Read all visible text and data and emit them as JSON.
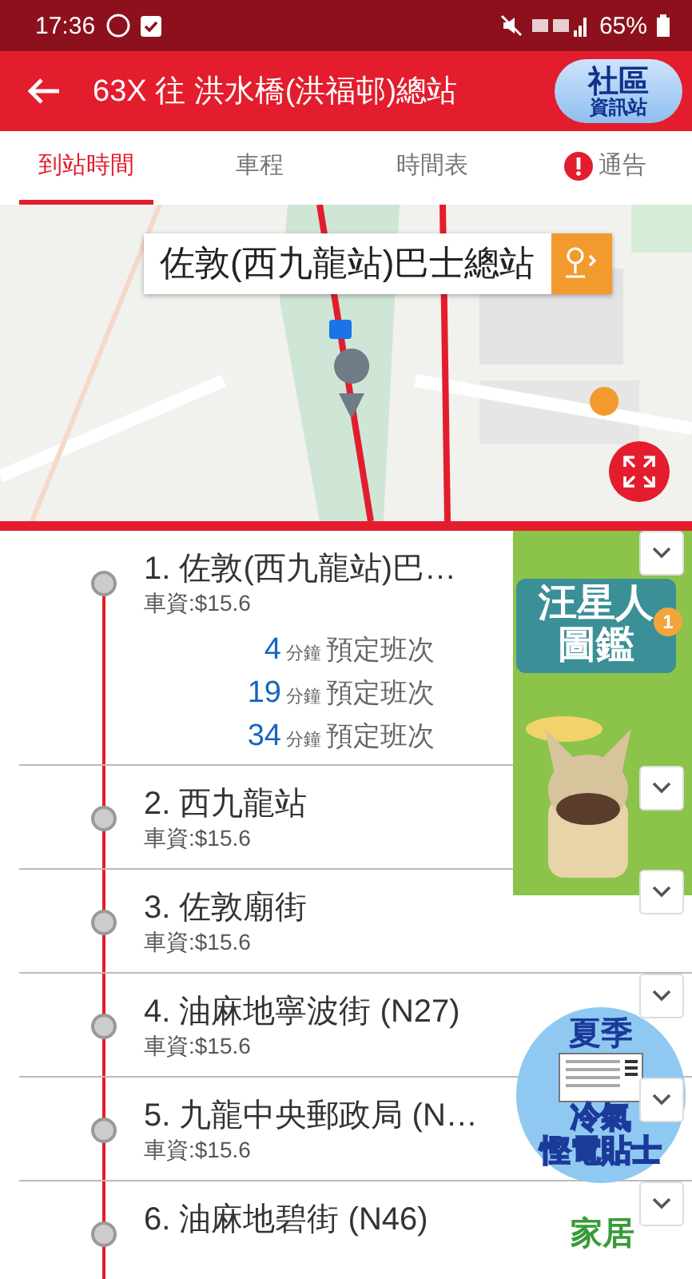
{
  "status_bar": {
    "time": "17:36",
    "battery": "65%"
  },
  "header": {
    "title": "63X 往 洪水橋(洪福邨)總站",
    "badge": [
      "社區",
      "資訊站"
    ]
  },
  "tabs": [
    {
      "label": "到站時間",
      "selected": true,
      "alert": false
    },
    {
      "label": "車程",
      "selected": false,
      "alert": false
    },
    {
      "label": "時間表",
      "selected": false,
      "alert": false
    },
    {
      "label": "通告",
      "selected": false,
      "alert": true
    }
  ],
  "map": {
    "kind": "picture",
    "callout": "佐敦(西九龍站)巴士總站"
  },
  "stops": [
    {
      "name": "1. 佐敦(西九龍站)巴…",
      "fare": "車資:$15.6",
      "etas": [
        {
          "minutes": "4",
          "unit": "分鐘",
          "note": "預定班次"
        },
        {
          "minutes": "19",
          "unit": "分鐘",
          "note": "預定班次"
        },
        {
          "minutes": "34",
          "unit": "分鐘",
          "note": "預定班次"
        }
      ]
    },
    {
      "name": "2. 西九龍站",
      "fare": "車資:$15.6"
    },
    {
      "name": "3. 佐敦廟街",
      "fare": "車資:$15.6"
    },
    {
      "name": "4. 油麻地寧波街 (N27)",
      "fare": "車資:$15.6"
    },
    {
      "name": "5. 九龍中央郵政局 (N…",
      "fare": "車資:$15.6"
    },
    {
      "name": "6. 油麻地碧街 (N46)"
    }
  ],
  "ads": [
    {
      "kind": "pet",
      "lines": [
        "汪星人",
        "圖鑑"
      ],
      "badge": "1"
    },
    {
      "kind": "aircon",
      "lines": [
        "夏季",
        "冷氣",
        "慳電貼士"
      ]
    },
    {
      "kind": "home",
      "lines": [
        "家居"
      ]
    }
  ]
}
